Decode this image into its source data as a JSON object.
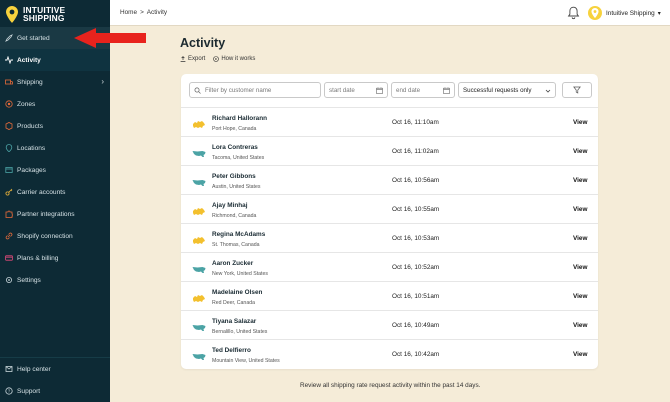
{
  "brand": {
    "name_line1": "INTUITIVE",
    "name_line2": "SHIPPING"
  },
  "sidebar": {
    "items": [
      {
        "label": "Get started",
        "icon": "rocket-icon"
      },
      {
        "label": "Activity",
        "icon": "activity-icon",
        "active": true
      },
      {
        "label": "Shipping",
        "icon": "shipping-icon",
        "has_children": true
      },
      {
        "label": "Zones",
        "icon": "zones-icon"
      },
      {
        "label": "Products",
        "icon": "products-icon"
      },
      {
        "label": "Locations",
        "icon": "locations-icon"
      },
      {
        "label": "Packages",
        "icon": "packages-icon"
      },
      {
        "label": "Carrier accounts",
        "icon": "key-icon"
      },
      {
        "label": "Partner integrations",
        "icon": "puzzle-icon"
      },
      {
        "label": "Shopify connection",
        "icon": "link-icon"
      },
      {
        "label": "Plans & billing",
        "icon": "card-icon"
      },
      {
        "label": "Settings",
        "icon": "gear-icon"
      }
    ],
    "bottom": [
      {
        "label": "Help center",
        "icon": "help-icon"
      },
      {
        "label": "Support",
        "icon": "support-icon"
      }
    ]
  },
  "topbar": {
    "breadcrumb": {
      "home": "Home",
      "separator": ">",
      "current": "Activity"
    },
    "user": "Intuitive Shipping"
  },
  "page": {
    "title": "Activity",
    "export_label": "Export",
    "how_label": "How it works"
  },
  "filters": {
    "search_placeholder": "Filter by customer name",
    "start_placeholder": "start date",
    "end_placeholder": "end date",
    "status_value": "Successful requests only"
  },
  "rows": [
    {
      "name": "Richard Hallorann",
      "location": "Port Hope, Canada",
      "time": "Oct 16, 11:10am",
      "view": "View",
      "country": "CA"
    },
    {
      "name": "Lora Contreras",
      "location": "Tacoma, United States",
      "time": "Oct 16, 11:02am",
      "view": "View",
      "country": "US"
    },
    {
      "name": "Peter Gibbons",
      "location": "Austin, United States",
      "time": "Oct 16, 10:56am",
      "view": "View",
      "country": "US"
    },
    {
      "name": "Ajay Minhaj",
      "location": "Richmond, Canada",
      "time": "Oct 16, 10:55am",
      "view": "View",
      "country": "CA"
    },
    {
      "name": "Regina McAdams",
      "location": "St. Thomas, Canada",
      "time": "Oct 16, 10:53am",
      "view": "View",
      "country": "CA"
    },
    {
      "name": "Aaron Zucker",
      "location": "New York, United States",
      "time": "Oct 16, 10:52am",
      "view": "View",
      "country": "US"
    },
    {
      "name": "Madelaine Olsen",
      "location": "Red Deer, Canada",
      "time": "Oct 16, 10:51am",
      "view": "View",
      "country": "CA"
    },
    {
      "name": "Tiyana Salazar",
      "location": "Bernalillo, United States",
      "time": "Oct 16, 10:49am",
      "view": "View",
      "country": "US"
    },
    {
      "name": "Ted Delfierro",
      "location": "Mountain View, United States",
      "time": "Oct 16, 10:42am",
      "view": "View",
      "country": "US"
    }
  ],
  "footer": "Review all shipping rate request activity within the past 14 days.",
  "colors": {
    "sidebar": "#0d2a35",
    "background": "#f5ecd8",
    "accent_yellow": "#f7d23d",
    "accent_teal": "#4ba3a5",
    "arrow_red": "#e8231d"
  }
}
